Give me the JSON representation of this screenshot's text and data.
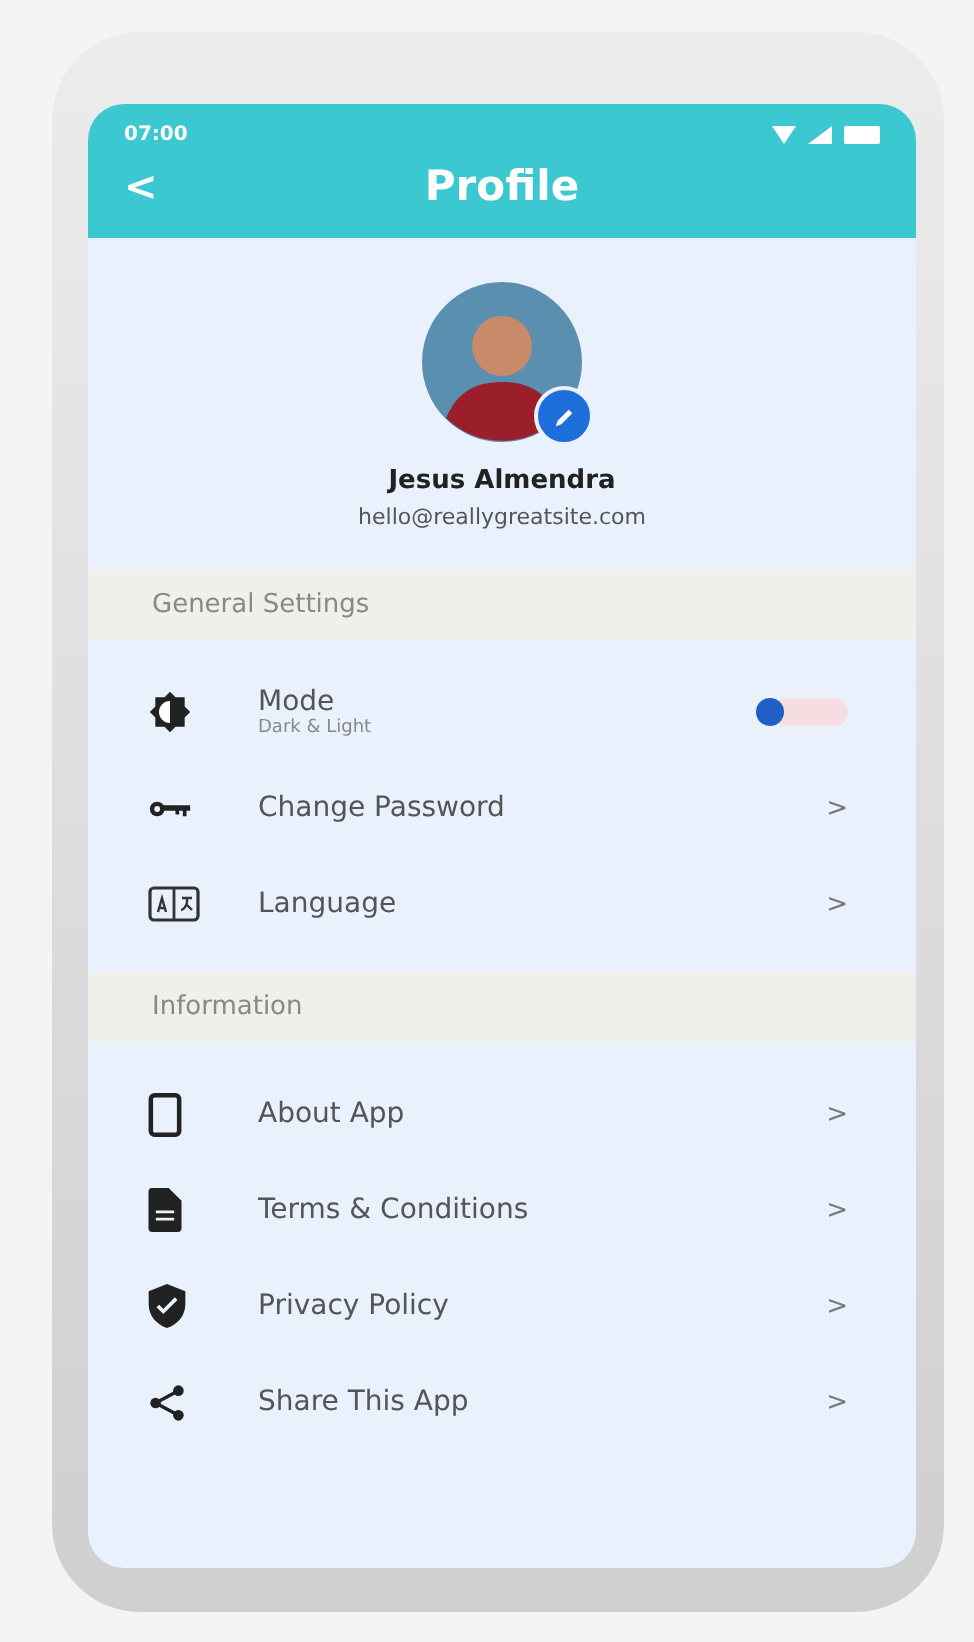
{
  "status_bar": {
    "time": "07:00"
  },
  "header": {
    "back": "<",
    "title": "Profile"
  },
  "profile": {
    "name": "Jesus Almendra",
    "email": "hello@reallygreatsite.com"
  },
  "sections": [
    {
      "title": "General Settings",
      "items": [
        {
          "kind": "toggle",
          "label": "Mode",
          "sublabel": "Dark & Light",
          "on": false
        },
        {
          "kind": "link",
          "label": "Change Password",
          "chevron": ">"
        },
        {
          "kind": "link",
          "label": "Language",
          "chevron": ">"
        }
      ]
    },
    {
      "title": "Information",
      "items": [
        {
          "kind": "link",
          "label": "About App",
          "chevron": ">"
        },
        {
          "kind": "link",
          "label": "Terms & Conditions",
          "chevron": ">"
        },
        {
          "kind": "link",
          "label": "Privacy Policy",
          "chevron": ">"
        },
        {
          "kind": "link",
          "label": "Share This App",
          "chevron": ">"
        }
      ]
    }
  ]
}
